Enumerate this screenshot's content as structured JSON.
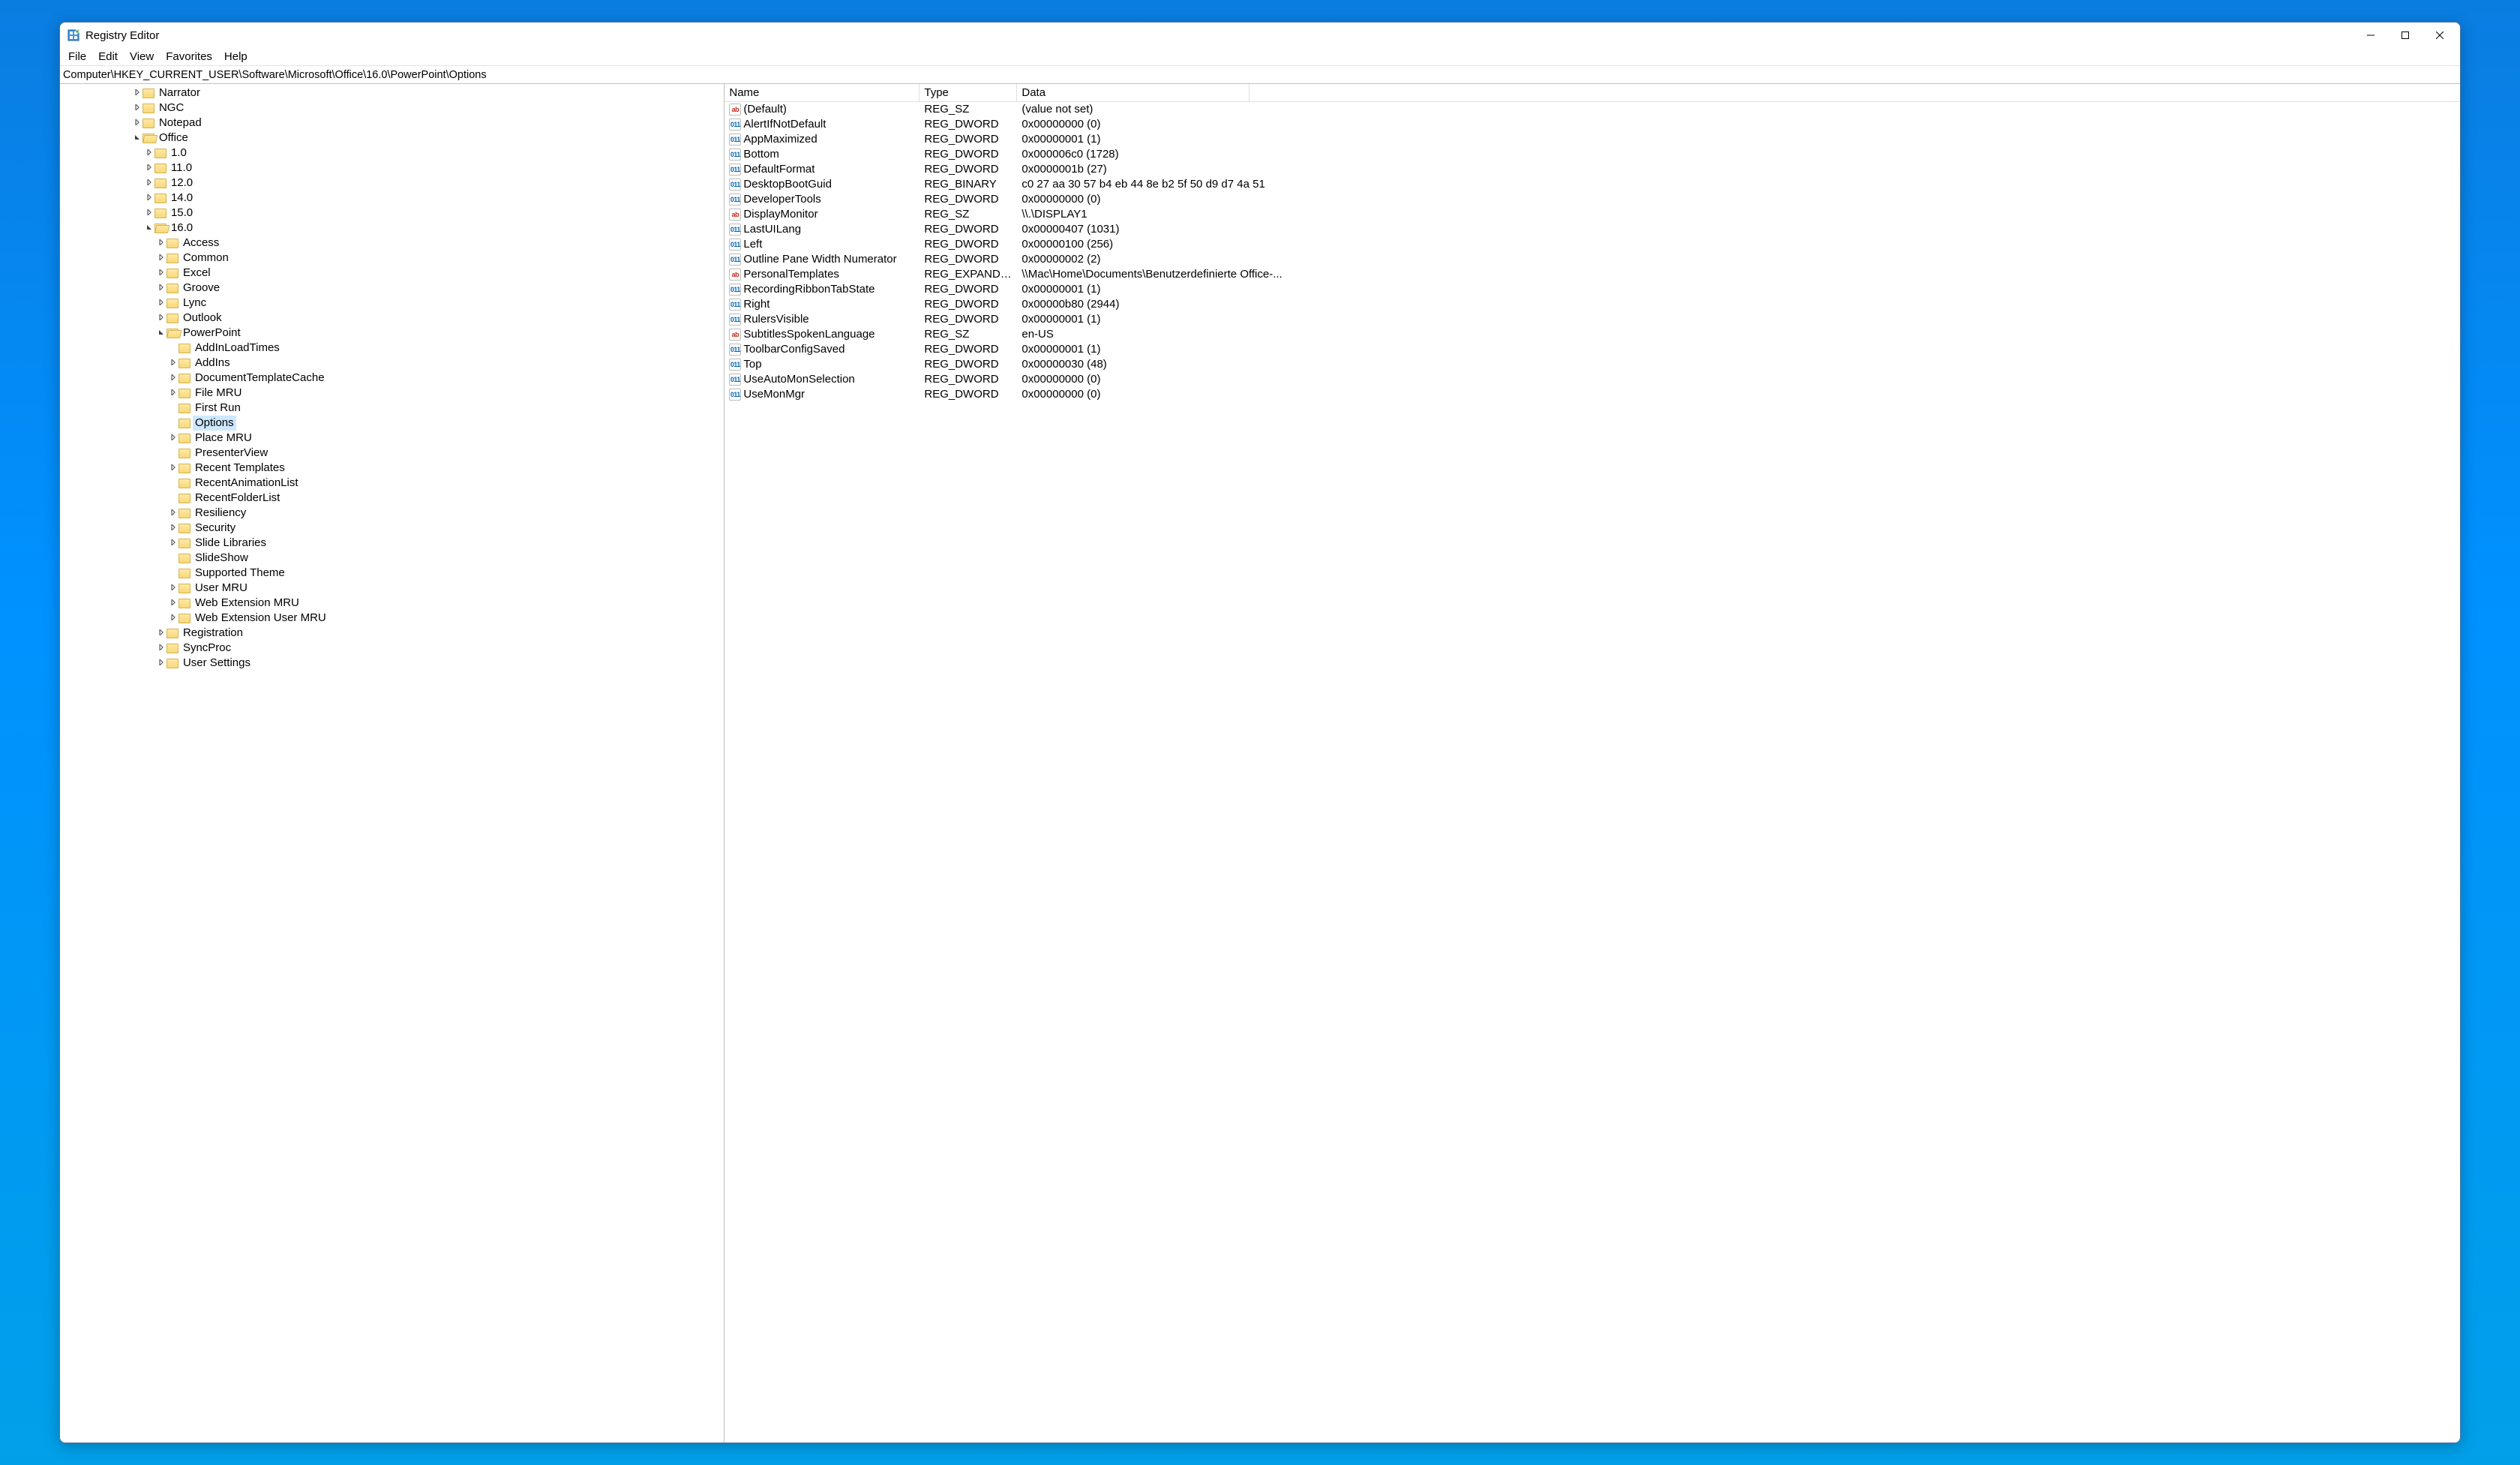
{
  "window": {
    "title": "Registry Editor"
  },
  "menu": {
    "file": "File",
    "edit": "Edit",
    "view": "View",
    "favorites": "Favorites",
    "help": "Help"
  },
  "address": "Computer\\HKEY_CURRENT_USER\\Software\\Microsoft\\Office\\16.0\\PowerPoint\\Options",
  "tree": [
    {
      "indent": 6,
      "arrow": "collapsed",
      "label": "Narrator"
    },
    {
      "indent": 6,
      "arrow": "collapsed",
      "label": "NGC"
    },
    {
      "indent": 6,
      "arrow": "collapsed",
      "label": "Notepad"
    },
    {
      "indent": 6,
      "arrow": "expanded",
      "label": "Office",
      "open": true
    },
    {
      "indent": 7,
      "arrow": "collapsed",
      "label": "1.0"
    },
    {
      "indent": 7,
      "arrow": "collapsed",
      "label": "11.0"
    },
    {
      "indent": 7,
      "arrow": "collapsed",
      "label": "12.0"
    },
    {
      "indent": 7,
      "arrow": "collapsed",
      "label": "14.0"
    },
    {
      "indent": 7,
      "arrow": "collapsed",
      "label": "15.0"
    },
    {
      "indent": 7,
      "arrow": "expanded",
      "label": "16.0",
      "open": true
    },
    {
      "indent": 8,
      "arrow": "collapsed",
      "label": "Access"
    },
    {
      "indent": 8,
      "arrow": "collapsed",
      "label": "Common"
    },
    {
      "indent": 8,
      "arrow": "collapsed",
      "label": "Excel"
    },
    {
      "indent": 8,
      "arrow": "collapsed",
      "label": "Groove"
    },
    {
      "indent": 8,
      "arrow": "collapsed",
      "label": "Lync"
    },
    {
      "indent": 8,
      "arrow": "collapsed",
      "label": "Outlook"
    },
    {
      "indent": 8,
      "arrow": "expanded",
      "label": "PowerPoint",
      "open": true
    },
    {
      "indent": 9,
      "arrow": "none",
      "label": "AddInLoadTimes"
    },
    {
      "indent": 9,
      "arrow": "collapsed",
      "label": "AddIns"
    },
    {
      "indent": 9,
      "arrow": "collapsed",
      "label": "DocumentTemplateCache"
    },
    {
      "indent": 9,
      "arrow": "collapsed",
      "label": "File MRU"
    },
    {
      "indent": 9,
      "arrow": "none",
      "label": "First Run"
    },
    {
      "indent": 9,
      "arrow": "none",
      "label": "Options",
      "selected": true
    },
    {
      "indent": 9,
      "arrow": "collapsed",
      "label": "Place MRU"
    },
    {
      "indent": 9,
      "arrow": "none",
      "label": "PresenterView"
    },
    {
      "indent": 9,
      "arrow": "collapsed",
      "label": "Recent Templates"
    },
    {
      "indent": 9,
      "arrow": "none",
      "label": "RecentAnimationList"
    },
    {
      "indent": 9,
      "arrow": "none",
      "label": "RecentFolderList"
    },
    {
      "indent": 9,
      "arrow": "collapsed",
      "label": "Resiliency"
    },
    {
      "indent": 9,
      "arrow": "collapsed",
      "label": "Security"
    },
    {
      "indent": 9,
      "arrow": "collapsed",
      "label": "Slide Libraries"
    },
    {
      "indent": 9,
      "arrow": "none",
      "label": "SlideShow"
    },
    {
      "indent": 9,
      "arrow": "none",
      "label": "Supported Theme"
    },
    {
      "indent": 9,
      "arrow": "collapsed",
      "label": "User MRU"
    },
    {
      "indent": 9,
      "arrow": "collapsed",
      "label": "Web Extension MRU"
    },
    {
      "indent": 9,
      "arrow": "collapsed",
      "label": "Web Extension User MRU"
    },
    {
      "indent": 8,
      "arrow": "collapsed",
      "label": "Registration"
    },
    {
      "indent": 8,
      "arrow": "collapsed",
      "label": "SyncProc"
    },
    {
      "indent": 8,
      "arrow": "collapsed",
      "label": "User Settings"
    }
  ],
  "columns": {
    "name": "Name",
    "type": "Type",
    "data": "Data"
  },
  "values": [
    {
      "icon": "sz",
      "name": "(Default)",
      "type": "REG_SZ",
      "data": "(value not set)"
    },
    {
      "icon": "bin",
      "name": "AlertIfNotDefault",
      "type": "REG_DWORD",
      "data": "0x00000000 (0)"
    },
    {
      "icon": "bin",
      "name": "AppMaximized",
      "type": "REG_DWORD",
      "data": "0x00000001 (1)"
    },
    {
      "icon": "bin",
      "name": "Bottom",
      "type": "REG_DWORD",
      "data": "0x000006c0 (1728)"
    },
    {
      "icon": "bin",
      "name": "DefaultFormat",
      "type": "REG_DWORD",
      "data": "0x0000001b (27)"
    },
    {
      "icon": "bin",
      "name": "DesktopBootGuid",
      "type": "REG_BINARY",
      "data": "c0 27 aa 30 57 b4 eb 44 8e b2 5f 50 d9 d7 4a 51"
    },
    {
      "icon": "bin",
      "name": "DeveloperTools",
      "type": "REG_DWORD",
      "data": "0x00000000 (0)"
    },
    {
      "icon": "sz",
      "name": "DisplayMonitor",
      "type": "REG_SZ",
      "data": "\\\\.\\DISPLAY1"
    },
    {
      "icon": "bin",
      "name": "LastUILang",
      "type": "REG_DWORD",
      "data": "0x00000407 (1031)"
    },
    {
      "icon": "bin",
      "name": "Left",
      "type": "REG_DWORD",
      "data": "0x00000100 (256)"
    },
    {
      "icon": "bin",
      "name": "Outline Pane Width Numerator",
      "type": "REG_DWORD",
      "data": "0x00000002 (2)"
    },
    {
      "icon": "sz",
      "name": "PersonalTemplates",
      "type": "REG_EXPAND_SZ",
      "data": "\\\\Mac\\Home\\Documents\\Benutzerdefinierte Office-..."
    },
    {
      "icon": "bin",
      "name": "RecordingRibbonTabState",
      "type": "REG_DWORD",
      "data": "0x00000001 (1)"
    },
    {
      "icon": "bin",
      "name": "Right",
      "type": "REG_DWORD",
      "data": "0x00000b80 (2944)"
    },
    {
      "icon": "bin",
      "name": "RulersVisible",
      "type": "REG_DWORD",
      "data": "0x00000001 (1)"
    },
    {
      "icon": "sz",
      "name": "SubtitlesSpokenLanguage",
      "type": "REG_SZ",
      "data": "en-US"
    },
    {
      "icon": "bin",
      "name": "ToolbarConfigSaved",
      "type": "REG_DWORD",
      "data": "0x00000001 (1)"
    },
    {
      "icon": "bin",
      "name": "Top",
      "type": "REG_DWORD",
      "data": "0x00000030 (48)"
    },
    {
      "icon": "bin",
      "name": "UseAutoMonSelection",
      "type": "REG_DWORD",
      "data": "0x00000000 (0)"
    },
    {
      "icon": "bin",
      "name": "UseMonMgr",
      "type": "REG_DWORD",
      "data": "0x00000000 (0)"
    }
  ]
}
